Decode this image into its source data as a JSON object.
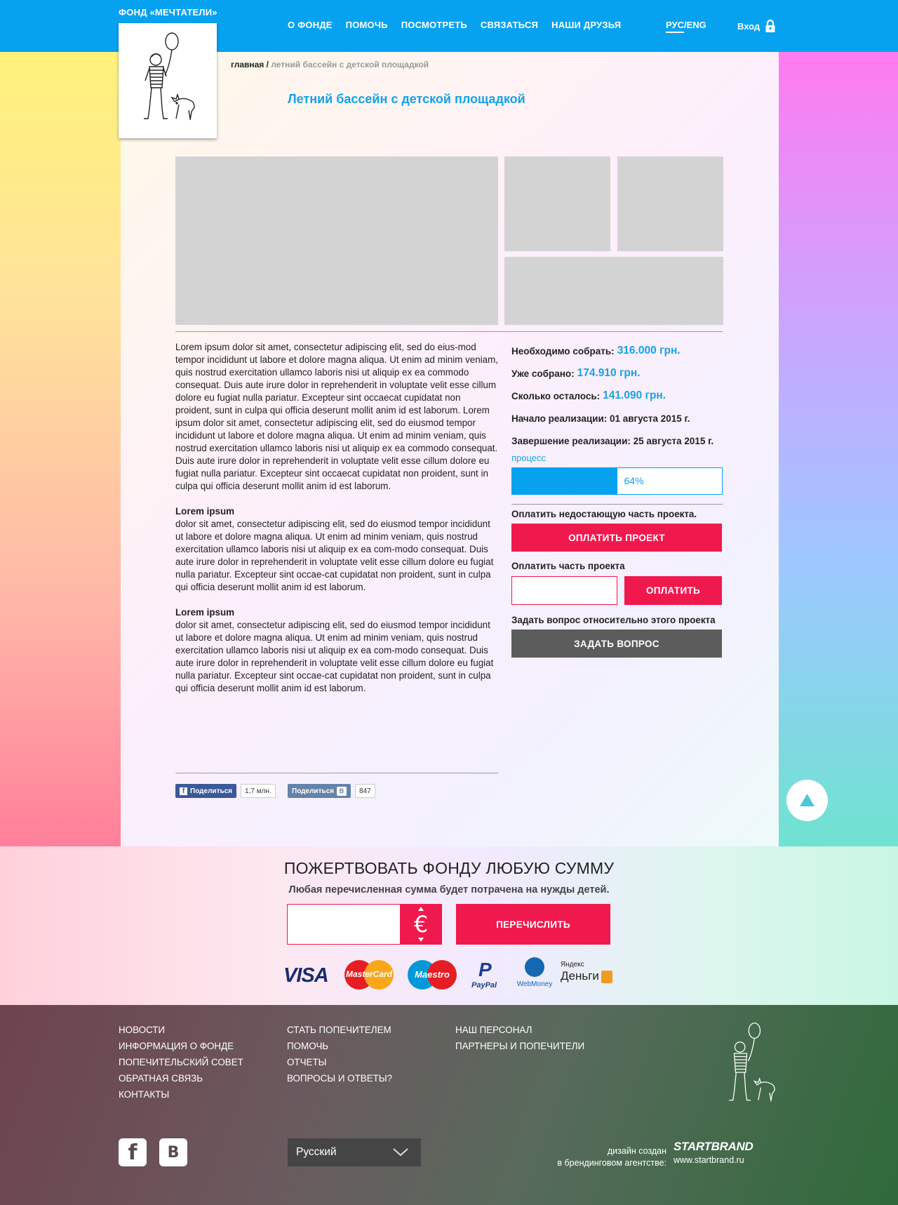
{
  "header": {
    "brand": "ФОНД «МЕЧТАТЕЛИ»",
    "nav": [
      "О ФОНДЕ",
      "ПОМОЧЬ",
      "ПОСМОТРЕТЬ",
      "СВЯЗАТЬСЯ",
      "НАШИ ДРУЗЬЯ"
    ],
    "lang_active": "РУС",
    "lang_sep": "/",
    "lang_other": "ENG",
    "login": "Вход"
  },
  "breadcrumb": {
    "home": "главная",
    "sep": " / ",
    "current": "летний бассейн с детской площадкой"
  },
  "page_title": "Летний бассейн с детской площадкой",
  "description": {
    "intro": "Lorem ipsum dolor sit amet, consectetur adipiscing elit, sed do eius-mod tempor incididunt ut labore et dolore magna aliqua. Ut enim ad minim veniam, quis nostrud exercitation ullamco laboris nisi ut aliquip ex ea commodo consequat. Duis aute irure dolor in reprehenderit in voluptate velit esse cillum dolore eu fugiat nulla pariatur. Excepteur sint occaecat cupidatat non proident, sunt in culpa qui officia deserunt mollit anim id est laborum. Lorem ipsum dolor sit amet, consectetur adipiscing elit, sed do eiusmod tempor incididunt ut labore et dolore magna aliqua. Ut enim ad minim veniam, quis nostrud exercitation ullamco laboris nisi ut aliquip ex ea commodo consequat. Duis aute irure dolor in reprehenderit in voluptate velit esse cillum dolore eu fugiat nulla pariatur. Excepteur sint occaecat cupidatat non proident, sunt in culpa qui officia deserunt mollit anim id est laborum.",
    "section1_title": "Lorem ipsum",
    "section1_text": "dolor sit amet, consectetur adipiscing elit, sed do eiusmod tempor incididunt ut labore et dolore magna aliqua. Ut enim ad minim veniam, quis nostrud exercitation ullamco laboris nisi ut aliquip ex ea com-modo consequat. Duis aute irure dolor in reprehenderit in voluptate velit esse cillum dolore eu fugiat nulla pariatur. Excepteur sint occae-cat cupidatat non proident, sunt in culpa qui officia deserunt mollit anim id est laborum.",
    "section2_title": "Lorem ipsum",
    "section2_text": "dolor sit amet, consectetur adipiscing elit, sed do eiusmod tempor incididunt ut labore et dolore magna aliqua. Ut enim ad minim veniam, quis nostrud exercitation ullamco laboris nisi ut aliquip ex ea com-modo consequat. Duis aute irure dolor in reprehenderit in voluptate velit esse cillum dolore eu fugiat nulla pariatur. Excepteur sint occae-cat cupidatat non proident, sunt in culpa qui officia deserunt mollit anim id est laborum."
  },
  "stats": [
    {
      "label": "Необходимо собрать:",
      "value": "316.000 грн."
    },
    {
      "label": "Уже собрано:",
      "value": "174.910 грн."
    },
    {
      "label": "Сколько осталось:",
      "value": "141.090 грн."
    },
    {
      "label": "Начало реализации: 01 августа 2015 г.",
      "value": ""
    },
    {
      "label": "Завершение реализации: 25 августа 2015 г.",
      "value": ""
    }
  ],
  "progress": {
    "label": "процесс",
    "percent_text": "64%",
    "fraction": 0.5
  },
  "pay_full": {
    "label": "Оплатить недостающую часть проекта.",
    "button": "ОПЛАТИТЬ ПРОЕКТ"
  },
  "pay_part": {
    "label": "Оплатить часть проекта",
    "button": "ОПЛАТИТЬ"
  },
  "ask": {
    "label": "Задать вопрос относительно этого проекта",
    "button": "ЗАДАТЬ ВОПРОС"
  },
  "share": {
    "fb_label": "Поделиться",
    "fb_count": "1,7 млн.",
    "vk_label": "Поделиться",
    "vk_count": "847"
  },
  "donate": {
    "title": "ПОЖЕРТВОВАТЬ ФОНДУ ЛЮБУЮ СУММУ",
    "subtitle": "Любая перечисленная сумма будет потрачена на нужды детей.",
    "currency_symbol": "€",
    "button": "ПЕРЕЧИСЛИТЬ",
    "payment_methods": {
      "visa": "VISA",
      "mastercard": "MasterCard",
      "maestro": "Maestro",
      "paypal": "PayPal",
      "webmoney": "WebMoney",
      "yandex_top": "Яндекс",
      "yandex_bottom": "Деньги"
    }
  },
  "footer": {
    "col1": [
      "НОВОСТИ",
      "ИНФОРМАЦИЯ О ФОНДЕ",
      "ПОПЕЧИТЕЛЬСКИЙ СОВЕТ",
      "ОБРАТНАЯ СВЯЗЬ",
      "КОНТАКТЫ"
    ],
    "col2": [
      "СТАТЬ ПОПЕЧИТЕЛЕМ",
      "ПОМОЧЬ",
      "ОТЧЕТЫ",
      "ВОПРОСЫ И ОТВЕТЫ?"
    ],
    "col3": [
      "НАШ ПЕРСОНАЛ",
      "ПАРТНЕРЫ И ПОПЕЧИТЕЛИ"
    ],
    "language": "Русский",
    "credit_line1": "дизайн создан",
    "credit_line2": "в брендинговом агентстве:",
    "agency": "STARTBRAND",
    "agency_url": "www.startbrand.ru"
  },
  "colors": {
    "primary": "#06a2ef",
    "accent": "#f0194e",
    "dark_button": "#5c5c5c"
  }
}
